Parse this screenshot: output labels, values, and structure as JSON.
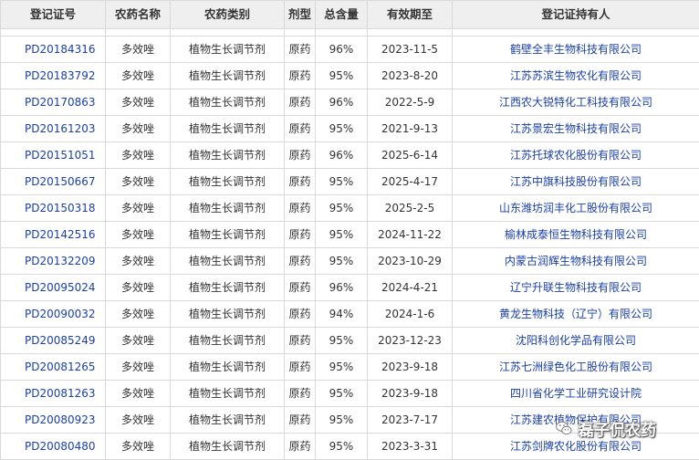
{
  "columns": [
    "登记证号",
    "农药名称",
    "农药类别",
    "剂型",
    "总含量",
    "有效期至",
    "登记证持有人"
  ],
  "rows": [
    [
      "PD20184316",
      "多效唑",
      "植物生长调节剂",
      "原药",
      "96%",
      "2023-11-5",
      "鹤壁全丰生物科技有限公司"
    ],
    [
      "PD20183792",
      "多效唑",
      "植物生长调节剂",
      "原药",
      "95%",
      "2023-8-20",
      "江苏苏滨生物农化有限公司"
    ],
    [
      "PD20170863",
      "多效唑",
      "植物生长调节剂",
      "原药",
      "96%",
      "2022-5-9",
      "江西农大锐特化工科技有限公司"
    ],
    [
      "PD20161203",
      "多效唑",
      "植物生长调节剂",
      "原药",
      "95%",
      "2021-9-13",
      "江苏景宏生物科技有限公司"
    ],
    [
      "PD20151051",
      "多效唑",
      "植物生长调节剂",
      "原药",
      "96%",
      "2025-6-14",
      "江苏托球农化股份有限公司"
    ],
    [
      "PD20150667",
      "多效唑",
      "植物生长调节剂",
      "原药",
      "95%",
      "2025-4-17",
      "江苏中旗科技股份有限公司"
    ],
    [
      "PD20150318",
      "多效唑",
      "植物生长调节剂",
      "原药",
      "95%",
      "2025-2-5",
      "山东潍坊润丰化工股份有限公司"
    ],
    [
      "PD20142516",
      "多效唑",
      "植物生长调节剂",
      "原药",
      "95%",
      "2024-11-22",
      "榆林成泰恒生物科技有限公司"
    ],
    [
      "PD20132209",
      "多效唑",
      "植物生长调节剂",
      "原药",
      "95%",
      "2023-10-29",
      "内蒙古润辉生物科技有限公司"
    ],
    [
      "PD20095024",
      "多效唑",
      "植物生长调节剂",
      "原药",
      "96%",
      "2024-4-21",
      "辽宁升联生物科技有限公司"
    ],
    [
      "PD20090032",
      "多效唑",
      "植物生长调节剂",
      "原药",
      "94%",
      "2024-1-6",
      "黄龙生物科技（辽宁）有限公司"
    ],
    [
      "PD20085249",
      "多效唑",
      "植物生长调节剂",
      "原药",
      "95%",
      "2023-12-23",
      "沈阳科创化学品有限公司"
    ],
    [
      "PD20081265",
      "多效唑",
      "植物生长调节剂",
      "原药",
      "95%",
      "2023-9-18",
      "江苏七洲绿色化工股份有限公司"
    ],
    [
      "PD20081263",
      "多效唑",
      "植物生长调节剂",
      "原药",
      "95%",
      "2023-9-18",
      "四川省化学工业研究设计院"
    ],
    [
      "PD20080923",
      "多效唑",
      "植物生长调节剂",
      "原药",
      "95%",
      "2023-7-17",
      "江苏建农植物保护有限公司"
    ],
    [
      "PD20080480",
      "多效唑",
      "植物生长调节剂",
      "原药",
      "95%",
      "2023-3-31",
      "江苏剑牌农化股份有限公司"
    ]
  ],
  "watermark": {
    "text": "磊子侃农药",
    "icon": "wechat-icon"
  }
}
